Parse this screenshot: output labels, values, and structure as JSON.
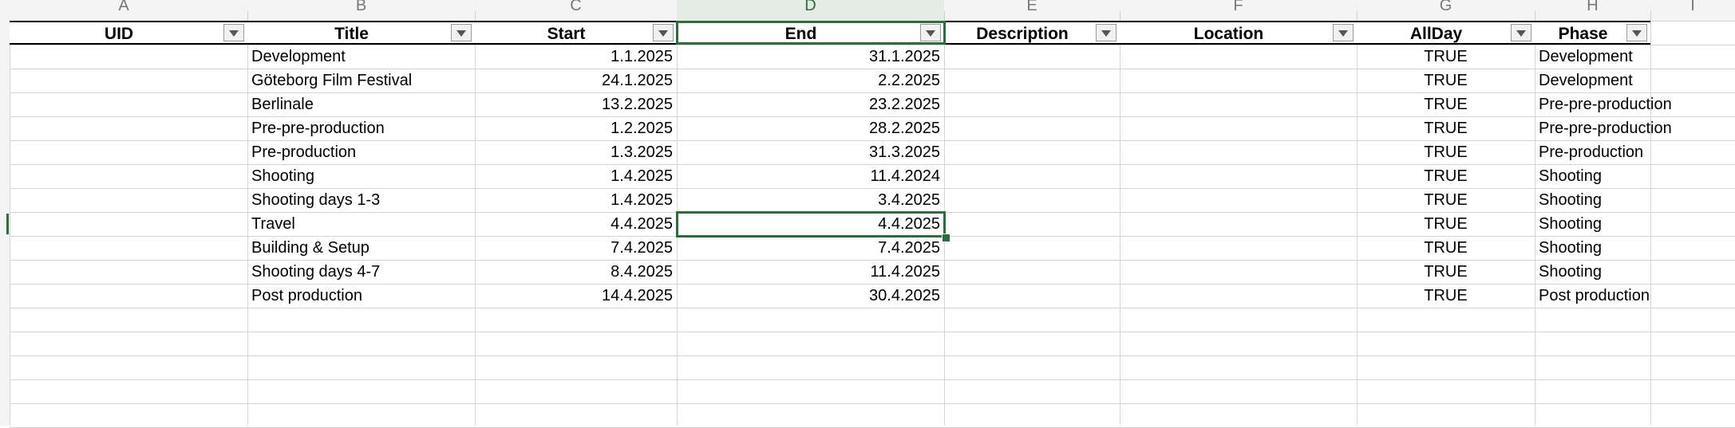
{
  "selected_cell": "D9",
  "column_letters": [
    "A",
    "B",
    "C",
    "D",
    "E",
    "F",
    "G",
    "H",
    "I"
  ],
  "headers": [
    "UID",
    "Title",
    "Start",
    "End",
    "Description",
    "Location",
    "AllDay",
    "Phase"
  ],
  "rows": [
    [
      "",
      "Development",
      "1.1.2025",
      "31.1.2025",
      "",
      "",
      "TRUE",
      "Development"
    ],
    [
      "",
      "Göteborg Film Festival",
      "24.1.2025",
      "2.2.2025",
      "",
      "",
      "TRUE",
      "Development"
    ],
    [
      "",
      "Berlinale",
      "13.2.2025",
      "23.2.2025",
      "",
      "",
      "TRUE",
      "Pre-pre-production"
    ],
    [
      "",
      "Pre-pre-production",
      "1.2.2025",
      "28.2.2025",
      "",
      "",
      "TRUE",
      "Pre-pre-production"
    ],
    [
      "",
      "Pre-production",
      "1.3.2025",
      "31.3.2025",
      "",
      "",
      "TRUE",
      "Pre-production"
    ],
    [
      "",
      "Shooting",
      "1.4.2025",
      "11.4.2024",
      "",
      "",
      "TRUE",
      "Shooting"
    ],
    [
      "",
      "Shooting days 1-3",
      "1.4.2025",
      "3.4.2025",
      "",
      "",
      "TRUE",
      "Shooting"
    ],
    [
      "",
      "Travel",
      "4.4.2025",
      "4.4.2025",
      "",
      "",
      "TRUE",
      "Shooting"
    ],
    [
      "",
      "Building & Setup",
      "7.4.2025",
      "7.4.2025",
      "",
      "",
      "TRUE",
      "Shooting"
    ],
    [
      "",
      "Shooting days 4-7",
      "8.4.2025",
      "11.4.2025",
      "",
      "",
      "TRUE",
      "Shooting"
    ],
    [
      "",
      "Post production",
      "14.4.2025",
      "30.4.2025",
      "",
      "",
      "TRUE",
      "Post production"
    ]
  ],
  "colors": {
    "accent": "#2f6b3e",
    "grid": "#d4d4d4",
    "header_bg": "#f4f4f4"
  },
  "filter_icon": "filter-dropdown-icon"
}
